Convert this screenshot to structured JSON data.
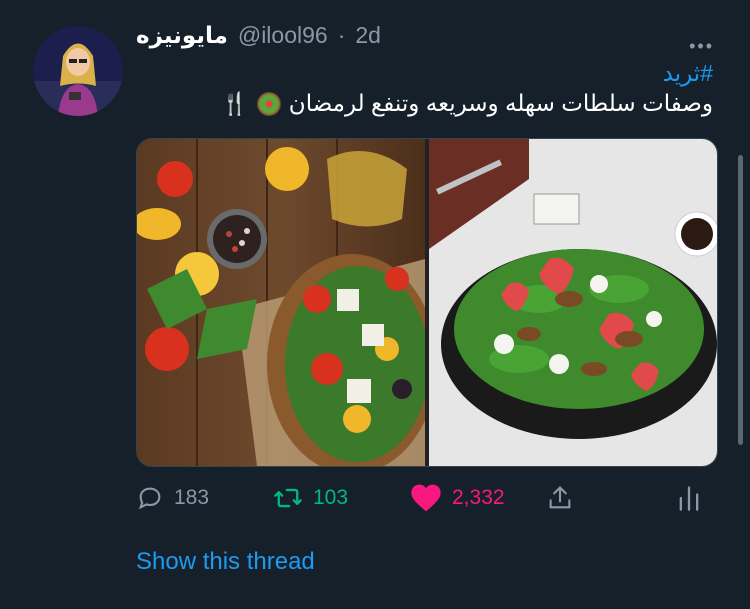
{
  "tweet": {
    "display_name": "مايونيزه",
    "handle": "@ilool96",
    "separator": "·",
    "time": "2d",
    "more_label": "•••",
    "hashtag": "#ثريد",
    "text": "وصفات سلطات سهله وسريعه وتنفع لرمضان"
  },
  "media": {
    "left_image": "salad-bowl-vegetables-icon",
    "right_image": "strawberry-pecan-salad-icon"
  },
  "actions": {
    "replies": "183",
    "retweets": "103",
    "likes": "2,332"
  },
  "thread_link": "Show this thread",
  "colors": {
    "background": "#15202b",
    "accent": "#1d9bf0",
    "retweet": "#00ba7c",
    "like": "#f91880",
    "muted": "#8b98a5"
  }
}
